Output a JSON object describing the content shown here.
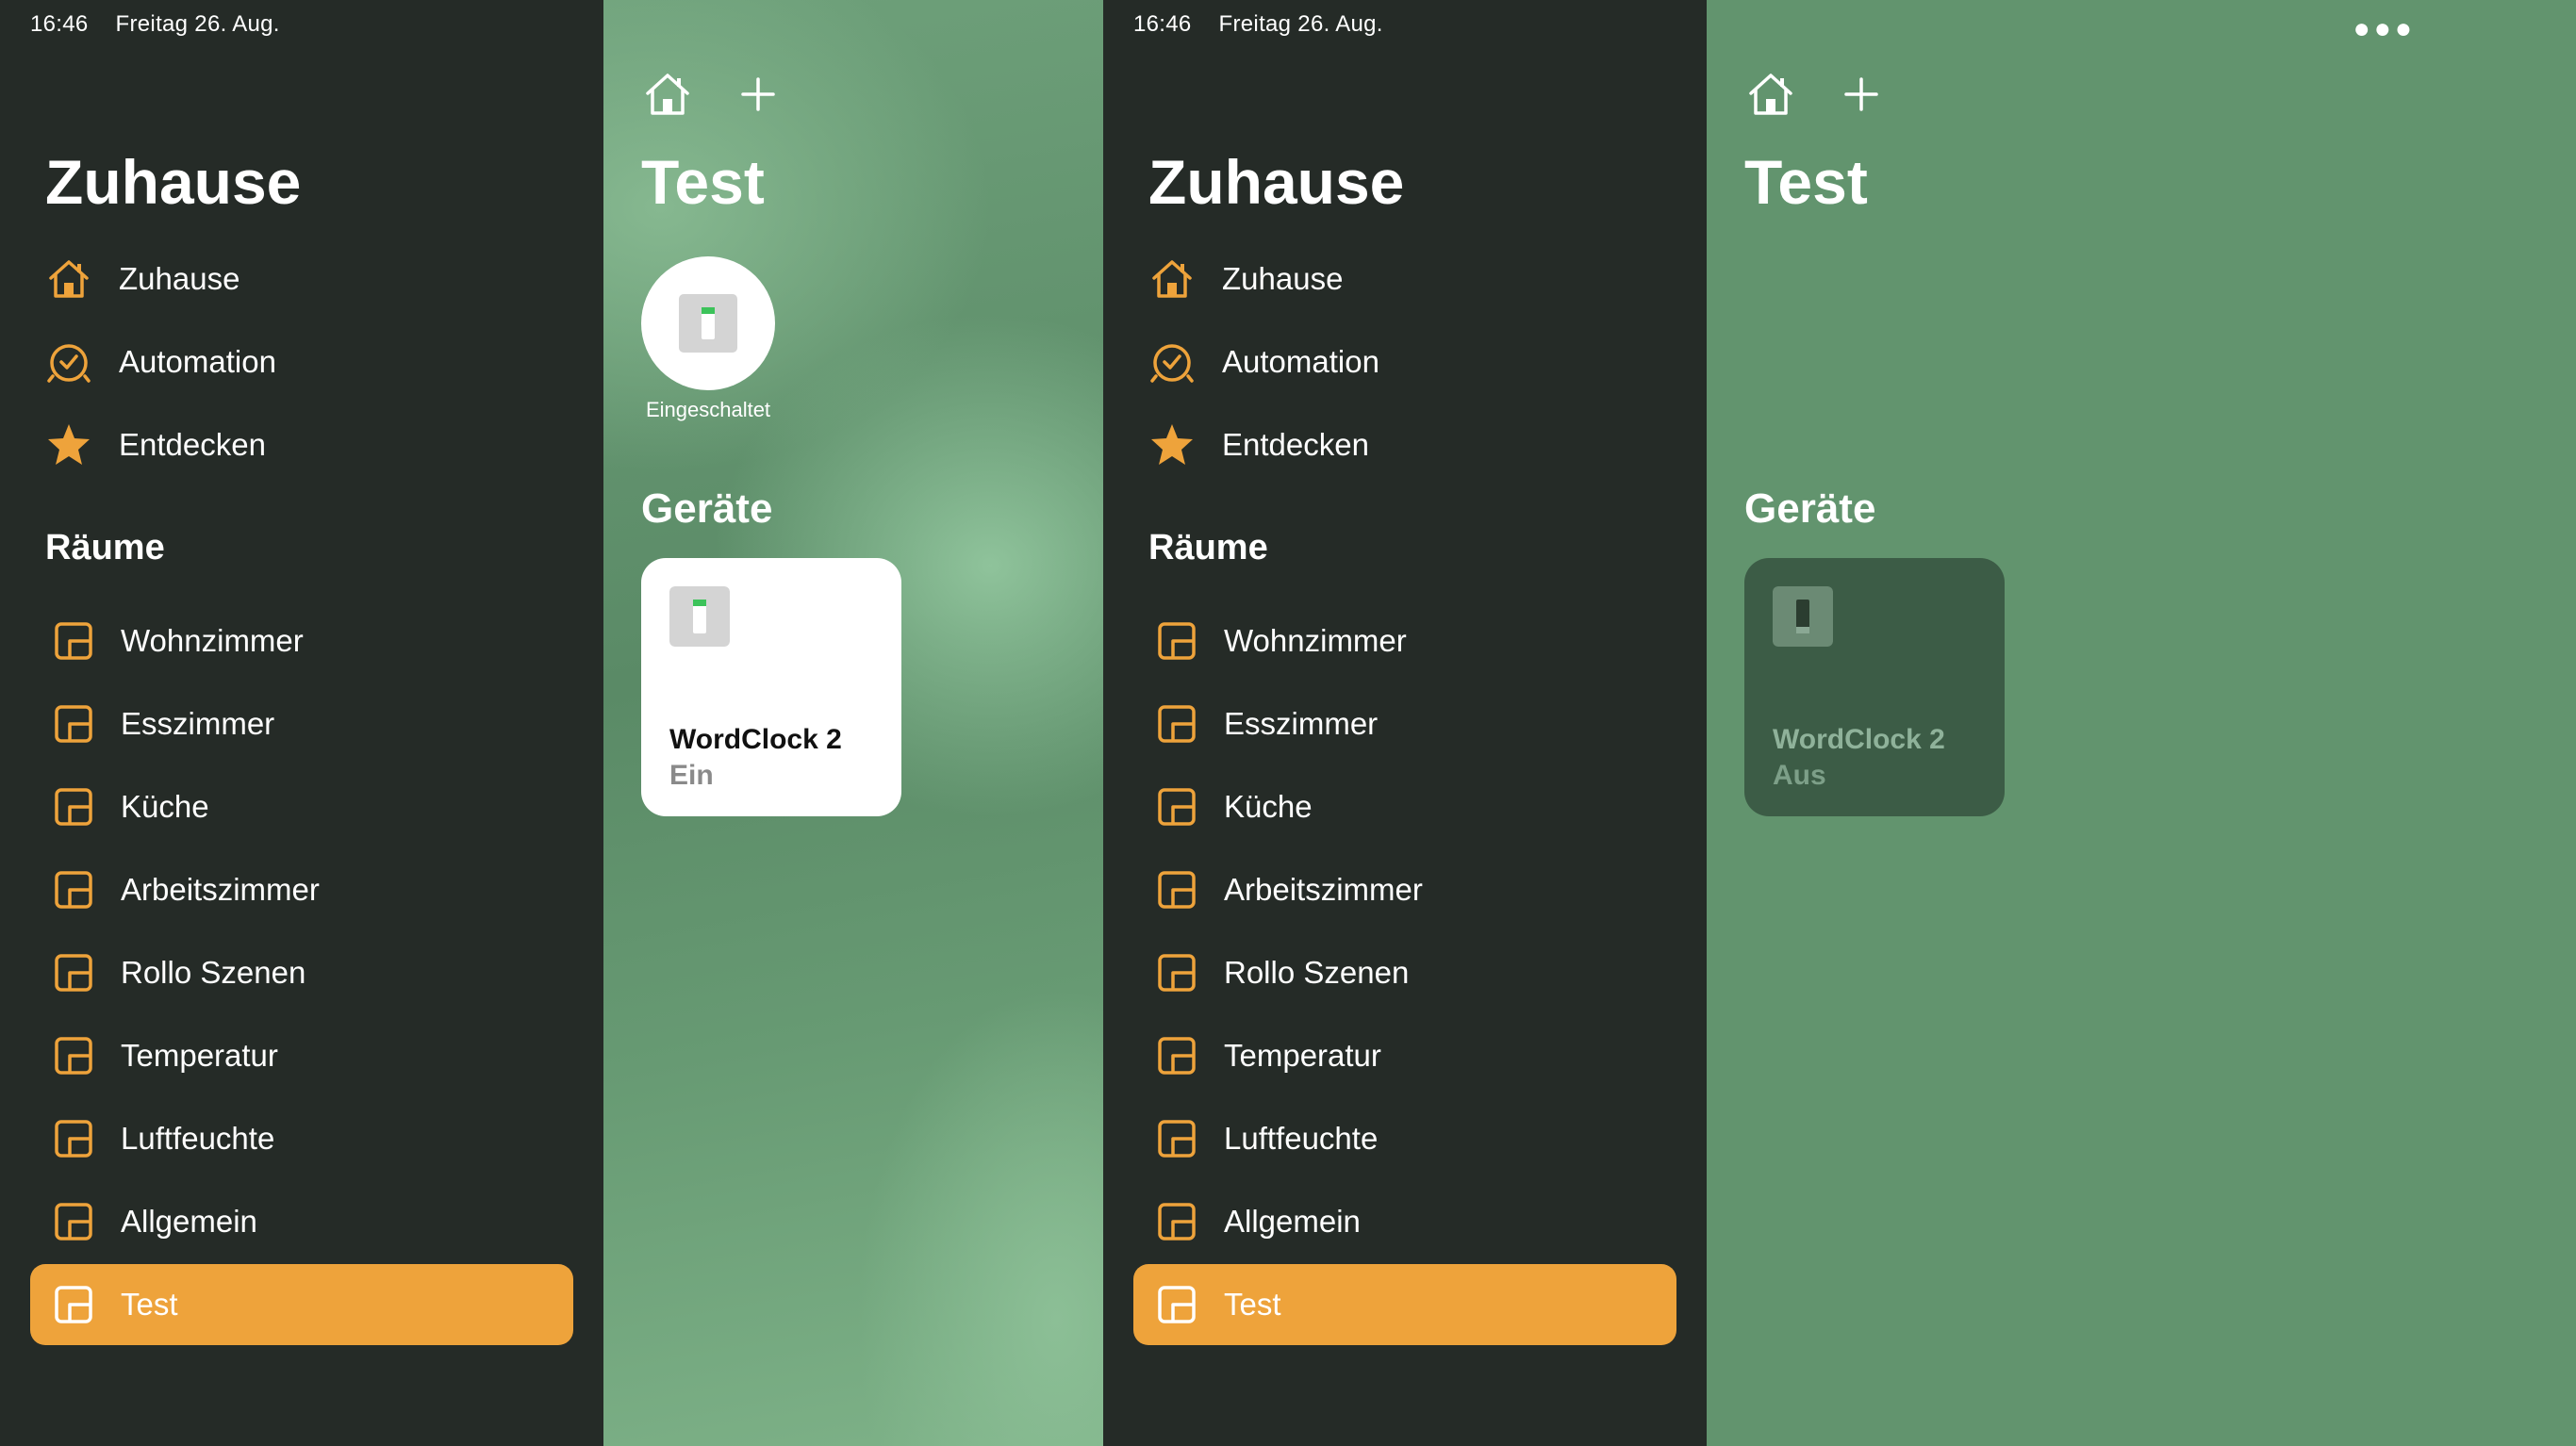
{
  "status": {
    "time": "16:46",
    "date": "Freitag 26. Aug."
  },
  "sidebar": {
    "title": "Zuhause",
    "nav": [
      {
        "label": "Zuhause",
        "icon": "house-icon"
      },
      {
        "label": "Automation",
        "icon": "clock-icon"
      },
      {
        "label": "Entdecken",
        "icon": "star-icon"
      }
    ],
    "rooms_title": "Räume",
    "rooms": [
      "Wohnzimmer",
      "Esszimmer",
      "Küche",
      "Arbeitszimmer",
      "Rollo Szenen",
      "Temperatur",
      "Luftfeuchte",
      "Allgemein",
      "Test"
    ],
    "active_room": "Test"
  },
  "left_view": {
    "title": "Test",
    "scene": {
      "label": "Eingeschaltet"
    },
    "devices_title": "Geräte",
    "device": {
      "name": "WordClock 2",
      "state": "Ein"
    }
  },
  "right_view": {
    "title": "Test",
    "devices_title": "Geräte",
    "device": {
      "name": "WordClock 2",
      "state": "Aus"
    },
    "more_icon": "ellipsis-icon"
  },
  "colors": {
    "accent": "#EEA33B",
    "sidebar_bg": "#252B27",
    "tile_on": "#FFFFFF",
    "tile_off": "#3C5C46"
  }
}
